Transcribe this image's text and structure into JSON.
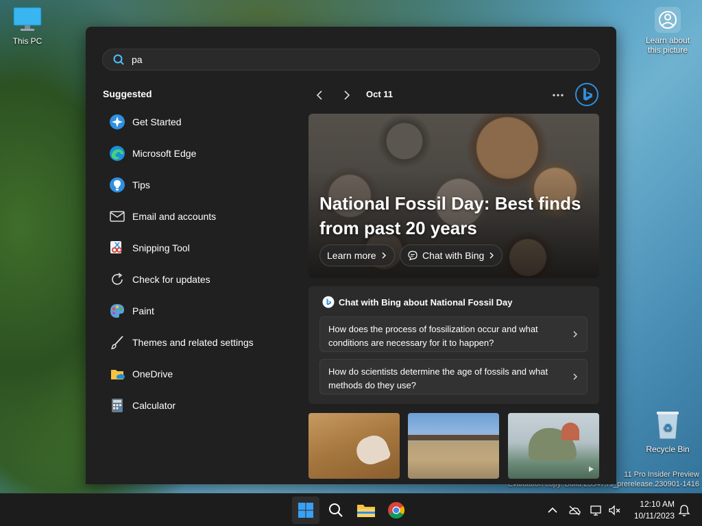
{
  "desktop": {
    "this_pc": "This PC",
    "learn_picture": "Learn about this picture",
    "recycle_bin": "Recycle Bin",
    "watermark_line1": "11 Pro Insider Preview",
    "watermark_line2": "Evaluation copy. Build 23547.rs_prerelease.230901-1416"
  },
  "search": {
    "query": "pa"
  },
  "suggested": {
    "title": "Suggested",
    "items": [
      {
        "label": "Get Started",
        "icon": "get-started-icon"
      },
      {
        "label": "Microsoft Edge",
        "icon": "edge-icon"
      },
      {
        "label": "Tips",
        "icon": "tips-icon"
      },
      {
        "label": "Email and accounts",
        "icon": "mail-icon"
      },
      {
        "label": "Snipping Tool",
        "icon": "snipping-tool-icon"
      },
      {
        "label": "Check for updates",
        "icon": "update-icon"
      },
      {
        "label": "Paint",
        "icon": "paint-icon"
      },
      {
        "label": "Themes and related settings",
        "icon": "brush-icon"
      },
      {
        "label": "OneDrive",
        "icon": "onedrive-icon"
      },
      {
        "label": "Calculator",
        "icon": "calculator-icon"
      }
    ]
  },
  "highlights": {
    "date": "Oct 11",
    "hero_title": "National Fossil Day: Best finds from past 20 years",
    "learn_more": "Learn more",
    "chat_with_bing": "Chat with Bing",
    "chat_card_title": "Chat with Bing about National Fossil Day",
    "questions": [
      "How does the process of fossilization occur and what conditions are necessary for it to happen?",
      "How do scientists determine the age of fossils and what methods do they use?"
    ]
  },
  "taskbar": {
    "time": "12:10 AM",
    "date": "10/11/2023"
  },
  "colors": {
    "panel_bg": "#202020",
    "accent_blue": "#2f8fe0"
  }
}
